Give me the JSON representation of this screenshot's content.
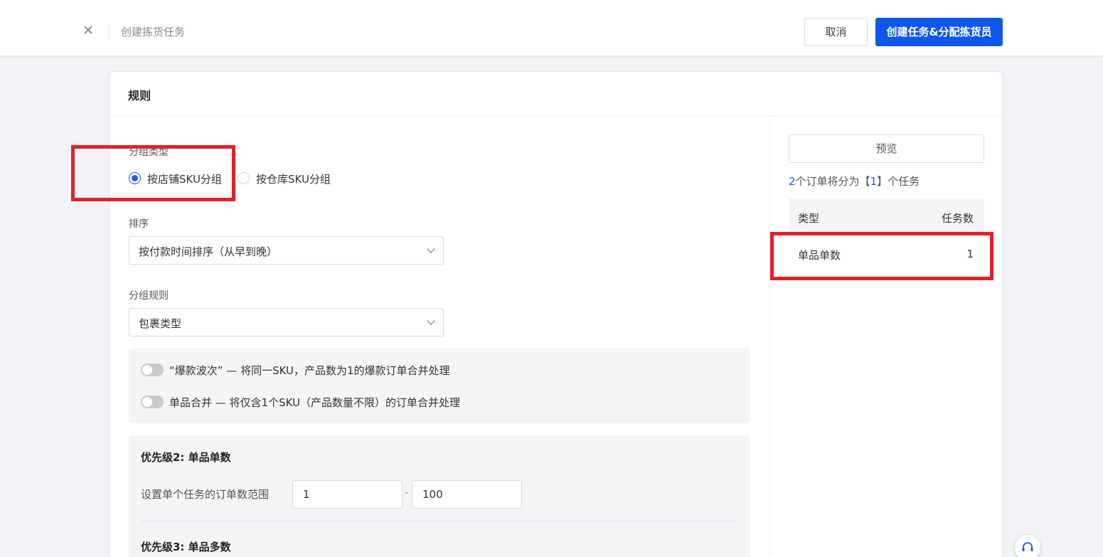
{
  "header": {
    "title": "创建拣货任务",
    "cancel_label": "取消",
    "primary_label": "创建任务&分配拣货员"
  },
  "rules": {
    "title": "规则",
    "group_type_label": "分组类型",
    "group_type_options": [
      {
        "label": "按店铺SKU分组",
        "checked": true
      },
      {
        "label": "按仓库SKU分组",
        "checked": false
      }
    ],
    "sort_label": "排序",
    "sort_value": "按付款时间排序（从早到晚）",
    "group_rule_label": "分组规则",
    "group_rule_value": "包裹类型",
    "toggles": [
      {
        "label": "“爆款波次” — 将同一SKU，产品数为1的爆款订单合并处理",
        "on": false
      },
      {
        "label": "单品合并 — 将仅含1个SKU（产品数量不限）的订单合并处理",
        "on": false
      }
    ],
    "priority2_title": "优先级2: 单品单数",
    "order_range_label": "设置单个任务的订单数范围",
    "range_min": "1",
    "range_sep": "-",
    "range_max": "100",
    "priority3_title": "优先级3: 单品多数"
  },
  "preview": {
    "button_label": "预览",
    "summary_count": "2",
    "summary_mid": "个订单将分为【",
    "summary_tasks": "1",
    "summary_end": "】个任务",
    "table_headers": {
      "type": "类型",
      "count": "任务数"
    },
    "rows": [
      {
        "type": "单品单数",
        "count": "1"
      }
    ]
  },
  "colors": {
    "primary": "#0f57ea",
    "highlight_border": "#e3202a",
    "link_number": "#1a5fe8"
  },
  "icons": {
    "close": "close-icon",
    "help": "headset-icon"
  }
}
